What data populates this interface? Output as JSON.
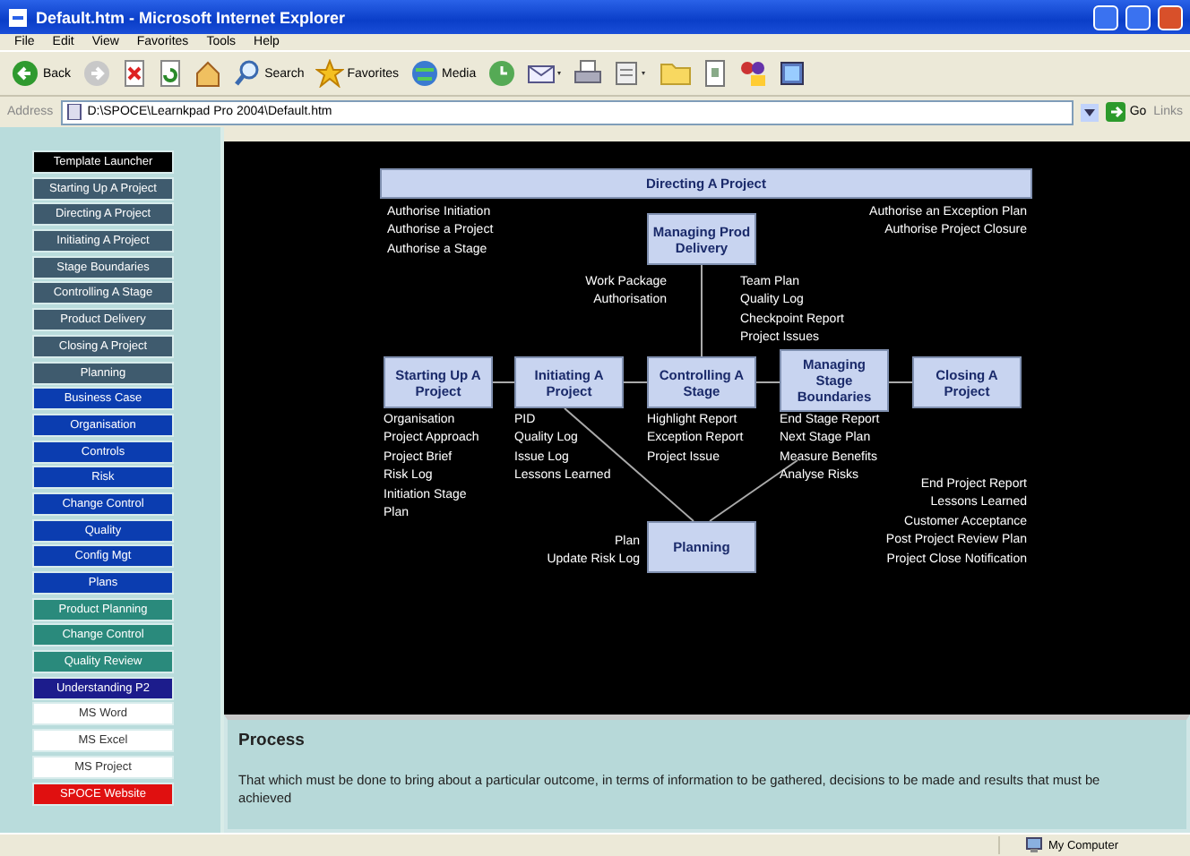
{
  "window": {
    "title": "Default.htm - Microsoft Internet Explorer"
  },
  "menu": [
    "File",
    "Edit",
    "View",
    "Favorites",
    "Tools",
    "Help"
  ],
  "toolbar": [
    {
      "kind": "back",
      "label": "Back"
    },
    {
      "kind": "forward"
    },
    {
      "kind": "stop"
    },
    {
      "kind": "refresh"
    },
    {
      "kind": "home"
    },
    {
      "kind": "search",
      "label": "Search"
    },
    {
      "kind": "favorites",
      "label": "Favorites"
    },
    {
      "kind": "media",
      "label": "Media"
    },
    {
      "kind": "history"
    },
    {
      "kind": "mail"
    },
    {
      "kind": "print"
    },
    {
      "kind": "edit"
    },
    {
      "kind": "folder"
    },
    {
      "kind": "page"
    },
    {
      "kind": "messenger"
    },
    {
      "kind": "tool"
    }
  ],
  "address": {
    "label": "Address",
    "value": "D:\\SPOCE\\Learnkpad Pro 2004\\Default.htm",
    "go": "Go",
    "links": "Links"
  },
  "sidebar": {
    "items": [
      {
        "label": "Template Launcher",
        "color": "#000000"
      },
      {
        "label": "Starting Up A Project",
        "color": "#3f5b6e"
      },
      {
        "label": "Directing A Project",
        "color": "#3f5b6e"
      },
      {
        "label": "Initiating A Project",
        "color": "#3f5b6e"
      },
      {
        "label": "Stage Boundaries",
        "color": "#3f5b6e"
      },
      {
        "label": "Controlling A Stage",
        "color": "#3f5b6e"
      },
      {
        "label": "Product Delivery",
        "color": "#3f5b6e"
      },
      {
        "label": "Closing A Project",
        "color": "#3f5b6e"
      },
      {
        "label": "Planning",
        "color": "#3f5b6e"
      },
      {
        "label": "Business Case",
        "color": "#0b3db0"
      },
      {
        "label": "Organisation",
        "color": "#0b3db0"
      },
      {
        "label": "Controls",
        "color": "#0b3db0"
      },
      {
        "label": "Risk",
        "color": "#0b3db0"
      },
      {
        "label": "Change Control",
        "color": "#0b3db0"
      },
      {
        "label": "Quality",
        "color": "#0b3db0"
      },
      {
        "label": "Config Mgt",
        "color": "#0b3db0"
      },
      {
        "label": "Plans",
        "color": "#0b3db0"
      },
      {
        "label": "Product Planning",
        "color": "#2a8a7c"
      },
      {
        "label": "Change Control",
        "color": "#2a8a7c"
      },
      {
        "label": "Quality Review",
        "color": "#2a8a7c"
      },
      {
        "label": "Understanding P2",
        "color": "#1c1c8c"
      },
      {
        "label": "MS Word",
        "color": "#ffffff"
      },
      {
        "label": "MS Excel",
        "color": "#ffffff"
      },
      {
        "label": "MS Project",
        "color": "#ffffff"
      },
      {
        "label": "SPOCE Website",
        "color": "#e01010"
      }
    ]
  },
  "diagram": {
    "header": "Directing A Project",
    "boxes": [
      "Managing Prod Delivery",
      "Starting Up A Project",
      "Initiating A Project",
      "Controlling A Stage",
      "Managing Stage Boundaries",
      "Closing A Project",
      "Planning"
    ],
    "notes": [
      [
        "Authorise Initiation",
        "Authorise a Project",
        "Authorise a Stage"
      ],
      [
        "Authorise an Exception Plan",
        "Authorise Project Closure"
      ],
      [
        "Work Package",
        "Authorisation"
      ],
      [
        "Team Plan",
        "Quality Log",
        "Checkpoint Report",
        "Project Issues"
      ],
      [
        "Organisation",
        "Project Approach",
        "Project Brief",
        "Risk Log",
        "Initiation Stage",
        "Plan"
      ],
      [
        "PID",
        "Quality Log",
        "Issue Log",
        "Lessons Learned"
      ],
      [
        "Highlight Report",
        "Exception Report",
        "Project Issue"
      ],
      [
        "End Stage Report",
        "Next Stage Plan",
        "Measure Benefits",
        "Analyse Risks"
      ],
      [
        "Plan",
        "Update Risk Log"
      ],
      [
        "End Project Report",
        "Lessons Learned",
        "Customer Acceptance",
        "Post Project Review Plan",
        "Project Close Notification"
      ]
    ]
  },
  "info": {
    "title": "Process",
    "text": "That which must be done to bring about a particular outcome, in terms of information to be gathered, decisions to be made and results that must be achieved"
  },
  "status_bar": {
    "zone": "My Computer"
  }
}
